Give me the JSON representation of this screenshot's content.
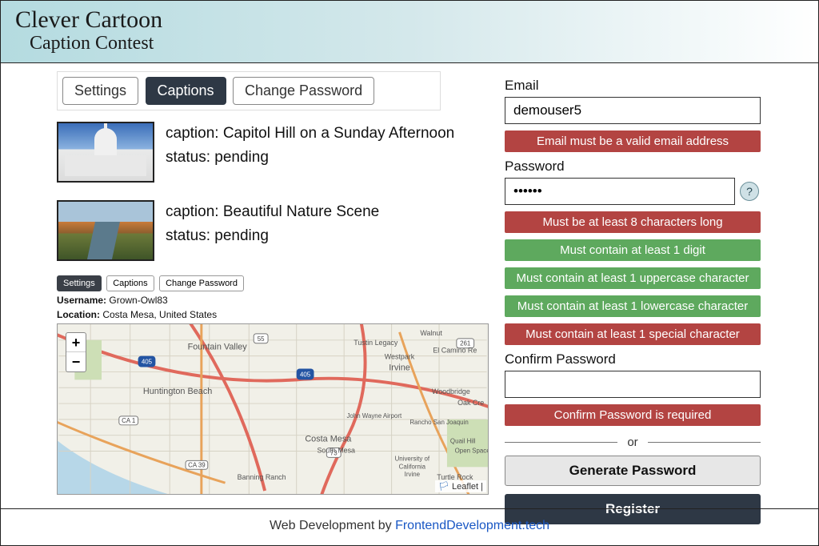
{
  "header": {
    "title": "Clever Cartoon",
    "subtitle": "Caption Contest"
  },
  "tabs": {
    "settings": "Settings",
    "captions": "Captions",
    "change_password": "Change Password"
  },
  "captions": [
    {
      "caption_label": "caption:",
      "caption_text": "Capitol Hill on a Sunday Afternoon",
      "status_label": "status:",
      "status_text": "pending"
    },
    {
      "caption_label": "caption:",
      "caption_text": "Beautiful Nature Scene",
      "status_label": "status:",
      "status_text": "pending"
    }
  ],
  "mini_tabs": {
    "settings": "Settings",
    "captions": "Captions",
    "change_password": "Change Password"
  },
  "profile": {
    "username_label": "Username:",
    "username_value": "Grown-Owl83",
    "location_label": "Location:",
    "location_value": "Costa Mesa, United States"
  },
  "map": {
    "places": {
      "fountain_valley": "Fountain Valley",
      "huntington_beach": "Huntington Beach",
      "costa_mesa": "Costa Mesa",
      "south_mesa": "South Mesa",
      "irvine": "Irvine",
      "tustin_legacy": "Tustin Legacy",
      "westpark": "Westpark",
      "walnut": "Walnut",
      "el_camino": "El Camino Re",
      "woodbridge": "Woodbridge",
      "oak_cr": "Oak Cre",
      "banning_ranch": "Banning Ranch",
      "john_wayne": "John Wayne Airport",
      "rancho": "Rancho San Joaquin",
      "quail_hill": "Quail Hill",
      "open_space": "Open Space",
      "turtle_rock": "Turtle Rock",
      "uci1": "University of",
      "uci2": "California",
      "uci3": "Irvine"
    },
    "routes": {
      "ca1": "CA 1",
      "ca39": "CA 39",
      "i405a": "405",
      "i405b": "405",
      "ca73": "73",
      "ca55": "55",
      "ca261": "261"
    },
    "zoom_in": "+",
    "zoom_out": "−",
    "attrib_icon": "🏳",
    "attrib_text": "Leaflet"
  },
  "form": {
    "email_label": "Email",
    "email_value": "demouser5",
    "email_err": "Email must be a valid email address",
    "password_label": "Password",
    "password_value": "••••••",
    "help_icon": "?",
    "pw_rule_len": "Must be at least 8 characters long",
    "pw_rule_digit": "Must contain at least 1 digit",
    "pw_rule_upper": "Must contain at least 1 uppercase character",
    "pw_rule_lower": "Must contain at least 1 lowercase character",
    "pw_rule_special": "Must contain at least 1 special character",
    "confirm_label": "Confirm Password",
    "confirm_value": "",
    "confirm_err": "Confirm Password is required",
    "divider": "or",
    "generate_btn": "Generate Password",
    "register_btn": "Register"
  },
  "footer": {
    "prefix": "Web Development by ",
    "link_text": "FrontendDevelopment.tech"
  }
}
